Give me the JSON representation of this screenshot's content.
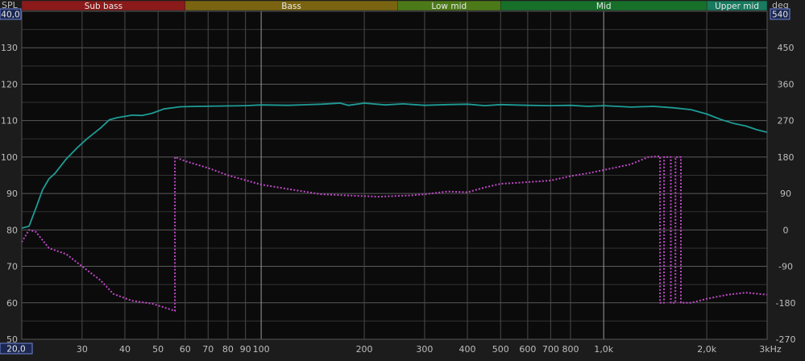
{
  "chart_data": {
    "type": "line",
    "x_axis": {
      "scale": "log",
      "range": [
        20,
        3000
      ],
      "start_label": "20,0",
      "end_label": "3kHz",
      "ticks": [
        {
          "v": 30,
          "label": "30"
        },
        {
          "v": 40,
          "label": "40"
        },
        {
          "v": 50,
          "label": "50"
        },
        {
          "v": 60,
          "label": "60"
        },
        {
          "v": 70,
          "label": "70"
        },
        {
          "v": 80,
          "label": "80"
        },
        {
          "v": 90,
          "label": "90"
        },
        {
          "v": 100,
          "label": "100"
        },
        {
          "v": 200,
          "label": "200"
        },
        {
          "v": 300,
          "label": "300"
        },
        {
          "v": 400,
          "label": "400"
        },
        {
          "v": 500,
          "label": "500"
        },
        {
          "v": 600,
          "label": "600"
        },
        {
          "v": 700,
          "label": "700"
        },
        {
          "v": 800,
          "label": "800"
        },
        {
          "v": 1000,
          "label": "1,0k"
        },
        {
          "v": 2000,
          "label": "2,0k"
        }
      ],
      "major_lines": [
        100,
        1000
      ]
    },
    "y_left": {
      "label": "SPL",
      "top_label": "40,0",
      "range": [
        50,
        140
      ],
      "ticks": [
        {
          "v": 50,
          "label": "50"
        },
        {
          "v": 60,
          "label": "60"
        },
        {
          "v": 70,
          "label": "70"
        },
        {
          "v": 80,
          "label": "80"
        },
        {
          "v": 90,
          "label": "90"
        },
        {
          "v": 100,
          "label": "100"
        },
        {
          "v": 110,
          "label": "110"
        },
        {
          "v": 120,
          "label": "120"
        },
        {
          "v": 130,
          "label": "130"
        }
      ]
    },
    "y_right": {
      "label": "deg",
      "top_label": "540",
      "range": [
        -270,
        540
      ],
      "ticks": [
        {
          "v": -270,
          "label": "-270"
        },
        {
          "v": -180,
          "label": "-180"
        },
        {
          "v": -90,
          "label": "-90"
        },
        {
          "v": 0,
          "label": "0"
        },
        {
          "v": 90,
          "label": "90"
        },
        {
          "v": 180,
          "label": "180"
        },
        {
          "v": 270,
          "label": "270"
        },
        {
          "v": 360,
          "label": "360"
        },
        {
          "v": 450,
          "label": "450"
        }
      ]
    },
    "bands": [
      {
        "label": "Sub bass",
        "from": 20,
        "to": 60,
        "color": "#8b1a1a"
      },
      {
        "label": "Bass",
        "from": 60,
        "to": 250,
        "color": "#7a6410"
      },
      {
        "label": "Low mid",
        "from": 250,
        "to": 500,
        "color": "#4d7a18"
      },
      {
        "label": "Mid",
        "from": 500,
        "to": 2000,
        "color": "#17702a"
      },
      {
        "label": "Upper mid",
        "from": 2000,
        "to": 4000,
        "color": "#187a5e"
      }
    ],
    "series": [
      {
        "axis": "left",
        "style": "solid",
        "color": "#1e9c96",
        "points": [
          [
            20,
            80.5
          ],
          [
            21,
            81
          ],
          [
            22,
            86
          ],
          [
            23,
            91
          ],
          [
            24,
            94
          ],
          [
            25,
            95.5
          ],
          [
            27,
            99.5
          ],
          [
            29,
            102.5
          ],
          [
            31,
            105
          ],
          [
            34,
            108
          ],
          [
            36,
            110.2
          ],
          [
            38,
            110.8
          ],
          [
            42,
            111.5
          ],
          [
            45,
            111.4
          ],
          [
            48,
            112
          ],
          [
            52,
            113.2
          ],
          [
            58,
            113.8
          ],
          [
            65,
            113.9
          ],
          [
            75,
            114
          ],
          [
            90,
            114.1
          ],
          [
            100,
            114.3
          ],
          [
            120,
            114.2
          ],
          [
            150,
            114.5
          ],
          [
            170,
            114.8
          ],
          [
            180,
            114.2
          ],
          [
            200,
            114.8
          ],
          [
            230,
            114.3
          ],
          [
            260,
            114.6
          ],
          [
            300,
            114.2
          ],
          [
            350,
            114.4
          ],
          [
            400,
            114.5
          ],
          [
            450,
            114.1
          ],
          [
            500,
            114.4
          ],
          [
            600,
            114.2
          ],
          [
            700,
            114.1
          ],
          [
            800,
            114.2
          ],
          [
            900,
            113.9
          ],
          [
            1000,
            114.1
          ],
          [
            1200,
            113.7
          ],
          [
            1400,
            113.9
          ],
          [
            1600,
            113.5
          ],
          [
            1800,
            113
          ],
          [
            2000,
            111.8
          ],
          [
            2200,
            110.3
          ],
          [
            2400,
            109.2
          ],
          [
            2600,
            108.5
          ],
          [
            2800,
            107.5
          ],
          [
            3000,
            106.8
          ]
        ]
      },
      {
        "axis": "right",
        "style": "dotted",
        "color": "#c048c8",
        "points": [
          [
            20,
            -30
          ],
          [
            21,
            0
          ],
          [
            22,
            -5
          ],
          [
            24,
            -45
          ],
          [
            27,
            -60
          ],
          [
            30,
            -90
          ],
          [
            34,
            -125
          ],
          [
            37,
            -158
          ],
          [
            42,
            -175
          ],
          [
            48,
            -182
          ],
          [
            56,
            -200
          ],
          [
            56.01,
            180
          ],
          [
            60,
            170
          ],
          [
            70,
            153
          ],
          [
            80,
            135
          ],
          [
            100,
            112
          ],
          [
            120,
            101
          ],
          [
            150,
            88
          ],
          [
            180,
            85
          ],
          [
            220,
            82
          ],
          [
            270,
            85
          ],
          [
            300,
            88
          ],
          [
            350,
            95
          ],
          [
            400,
            93
          ],
          [
            450,
            105
          ],
          [
            500,
            114
          ],
          [
            600,
            118
          ],
          [
            700,
            122
          ],
          [
            800,
            133
          ],
          [
            900,
            140
          ],
          [
            1000,
            148
          ],
          [
            1200,
            162
          ],
          [
            1350,
            180
          ],
          [
            1460,
            182
          ],
          [
            1460.1,
            -180
          ],
          [
            1500,
            -180
          ],
          [
            1500.1,
            180
          ],
          [
            1570,
            180
          ],
          [
            1570.1,
            -180
          ],
          [
            1620,
            -180
          ],
          [
            1620.1,
            180
          ],
          [
            1680,
            180
          ],
          [
            1680.1,
            -180
          ],
          [
            1800,
            -180
          ],
          [
            2000,
            -170
          ],
          [
            2300,
            -160
          ],
          [
            2600,
            -155
          ],
          [
            3000,
            -160
          ]
        ]
      }
    ]
  }
}
